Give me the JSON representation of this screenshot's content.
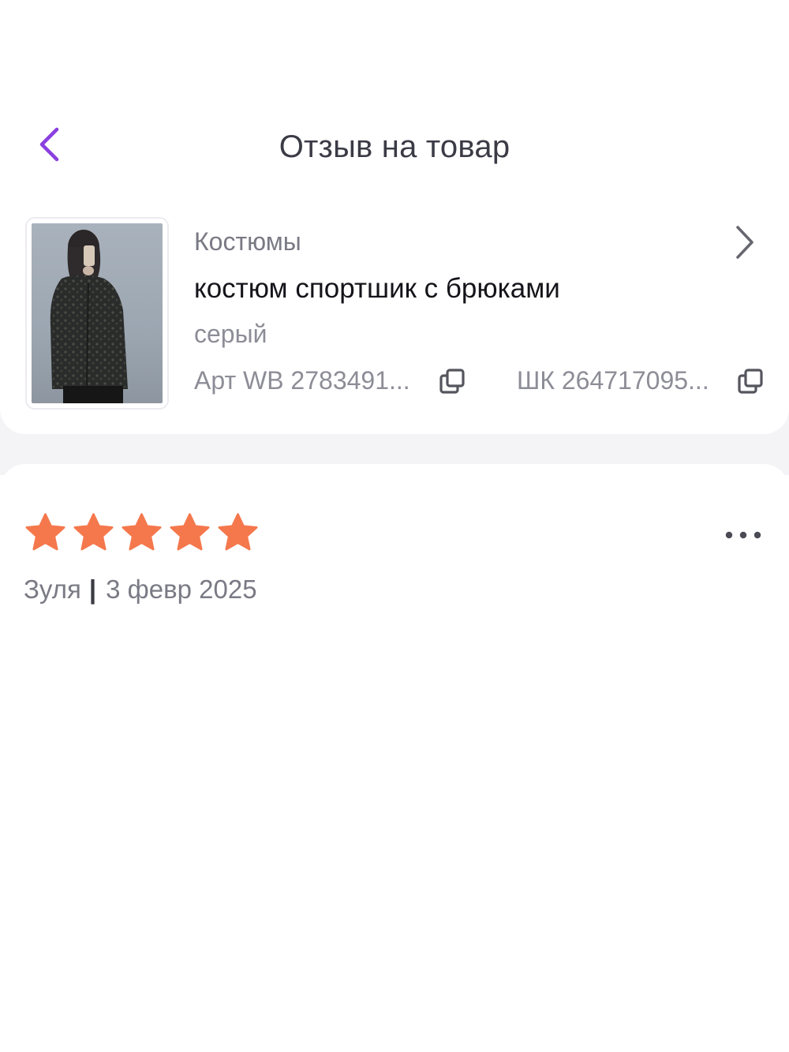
{
  "header": {
    "title": "Отзыв на товар",
    "back_icon": "chevron-left-icon",
    "accent_color": "#8b3fe0"
  },
  "product": {
    "category": "Костюмы",
    "name": "костюм спортшик с брюками",
    "color": "серый",
    "article_label": "Арт WB 2783491...",
    "barcode_label": "ШК 264717095...",
    "copy_icon": "copy-icon",
    "open_icon": "chevron-right-icon"
  },
  "review": {
    "rating": 5,
    "rating_max": 5,
    "star_color": "#f5784d",
    "author": "Зуля",
    "separator": "|",
    "date": "3 февр 2025",
    "more_icon": "more-horizontal-icon"
  }
}
